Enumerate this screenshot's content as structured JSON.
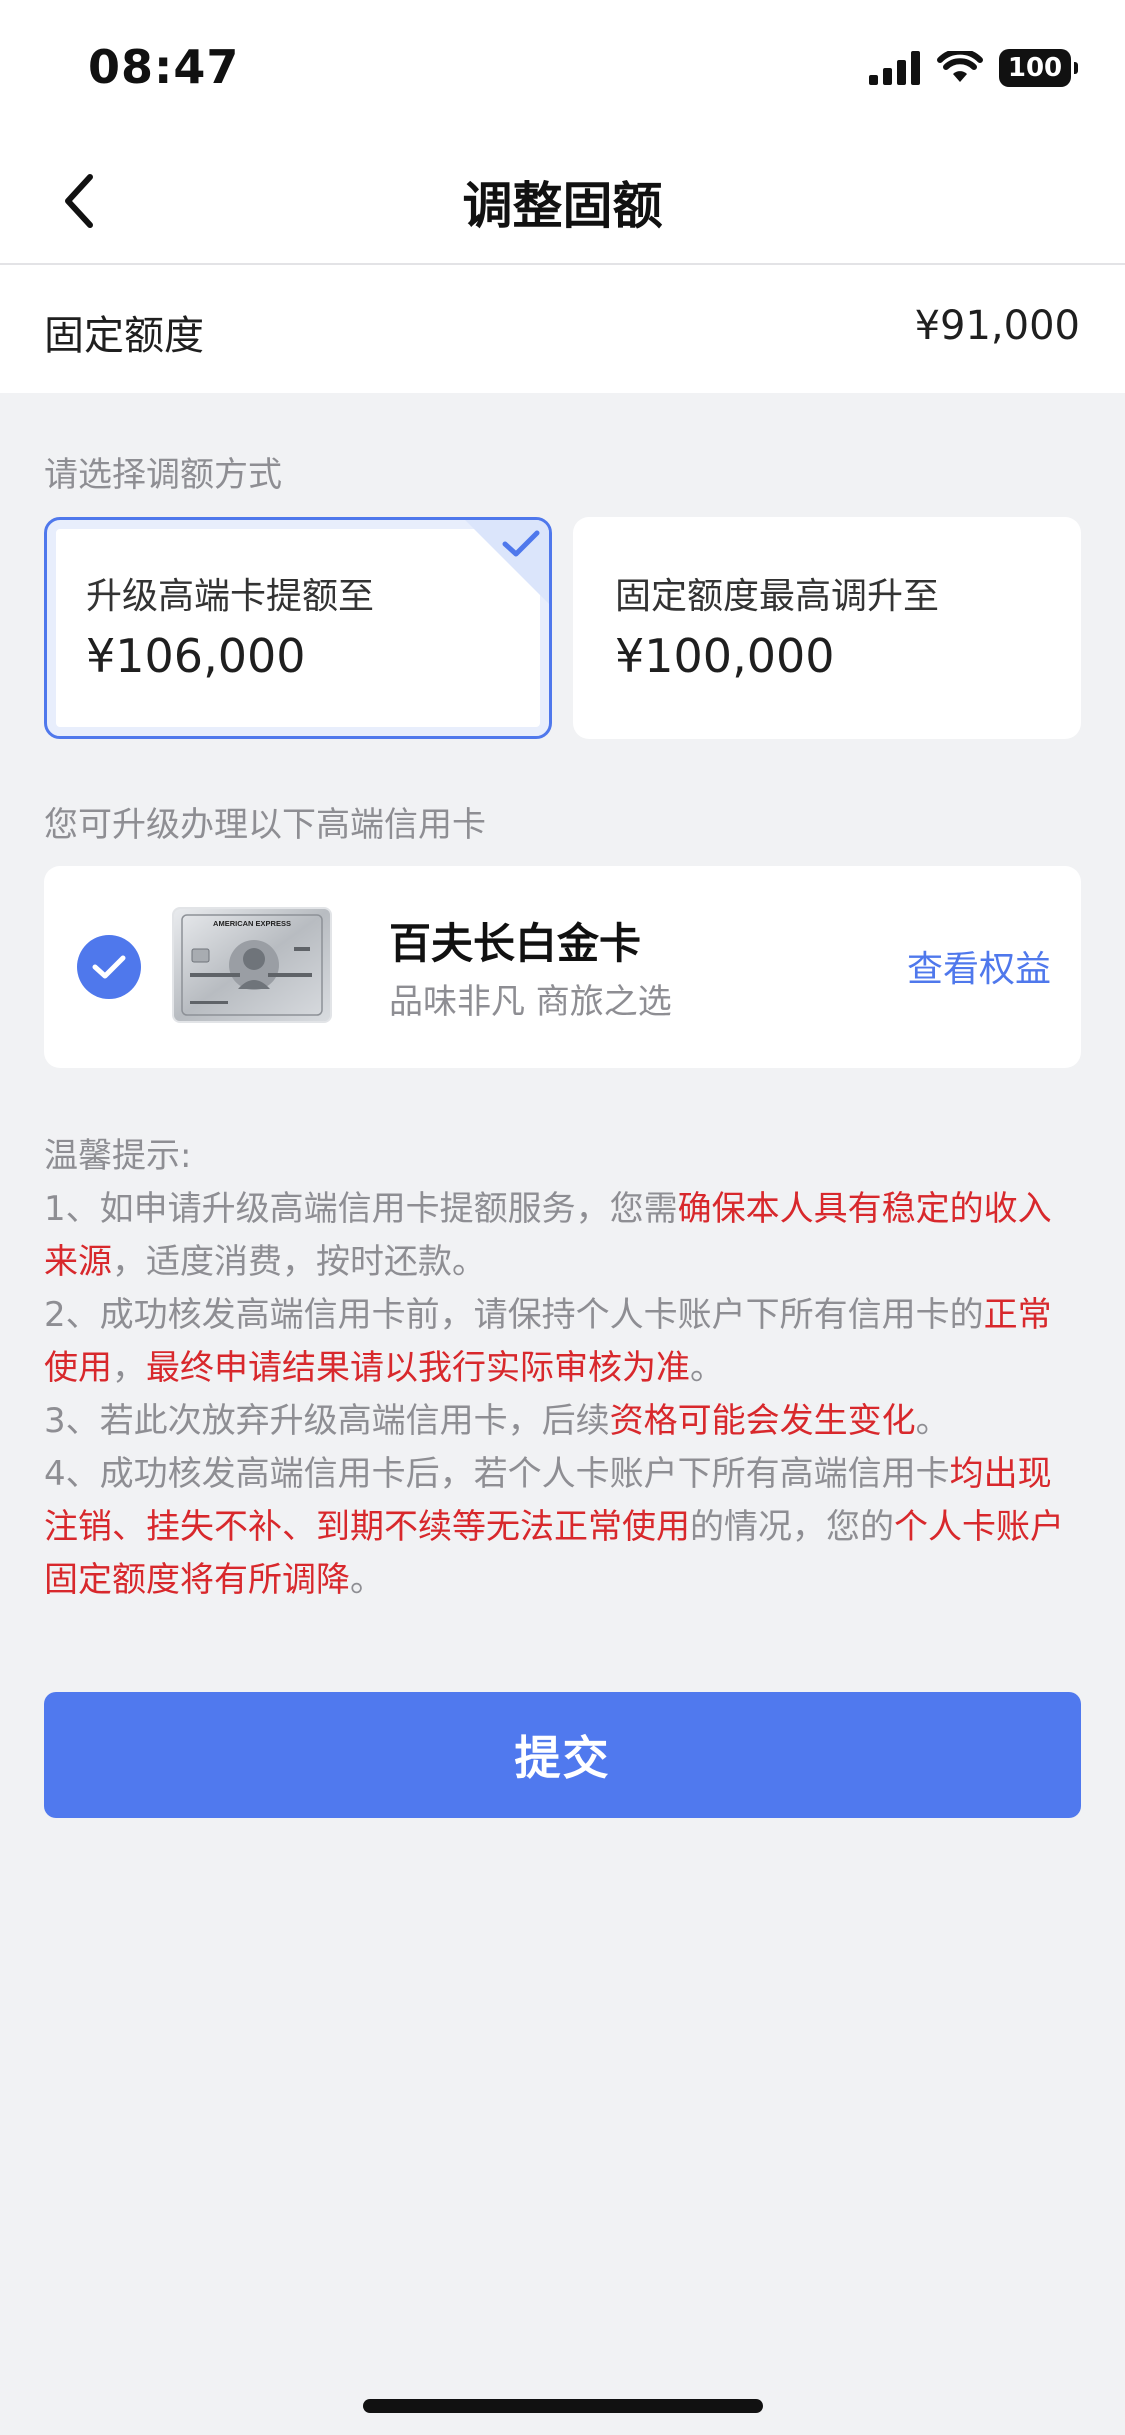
{
  "status": {
    "time": "08:47",
    "battery": "100"
  },
  "nav": {
    "title": "调整固额"
  },
  "fixed_limit": {
    "label": "固定额度",
    "value": "¥91,000"
  },
  "method": {
    "section_label": "请选择调额方式",
    "options": [
      {
        "title": "升级高端卡提额至",
        "amount": "¥106,000",
        "selected": true
      },
      {
        "title": "固定额度最高调升至",
        "amount": "¥100,000",
        "selected": false
      }
    ]
  },
  "upgrade": {
    "section_label": "您可升级办理以下高端信用卡",
    "card": {
      "name": "百夫长白金卡",
      "subtitle": "品味非凡 商旅之选",
      "link": "查看权益",
      "image_brand_text": "AMERICAN EXPRESS",
      "selected": true
    }
  },
  "tips": {
    "heading": "温馨提示:",
    "items": [
      {
        "p1": "1、如申请升级高端信用卡提额服务，您需",
        "h1": "确保本人具有稳定的收入来源",
        "p2": "，适度消费，按时还款。"
      },
      {
        "p1": "2、成功核发高端信用卡前，请保持个人卡账户下所有信用卡的",
        "h1": "正常使用",
        "p2": "，",
        "h2": "最终申请结果请以我行实际审核为准",
        "p3": "。"
      },
      {
        "p1": "3、若此次放弃升级高端信用卡，后续",
        "h1": "资格可能会发生变化",
        "p2": "。"
      },
      {
        "p1": "4、成功核发高端信用卡后，若个人卡账户下所有高端信用卡",
        "h1": "均出现注销、挂失不补、到期不续等无法正常使用",
        "p2": "的情况，您的",
        "h2": "个人卡账户固定额度将有所调降",
        "p3": "。"
      }
    ]
  },
  "submit": {
    "label": "提交"
  },
  "colors": {
    "accent": "#4f78ec",
    "warning": "#d8282c",
    "background": "#f1f2f4"
  }
}
